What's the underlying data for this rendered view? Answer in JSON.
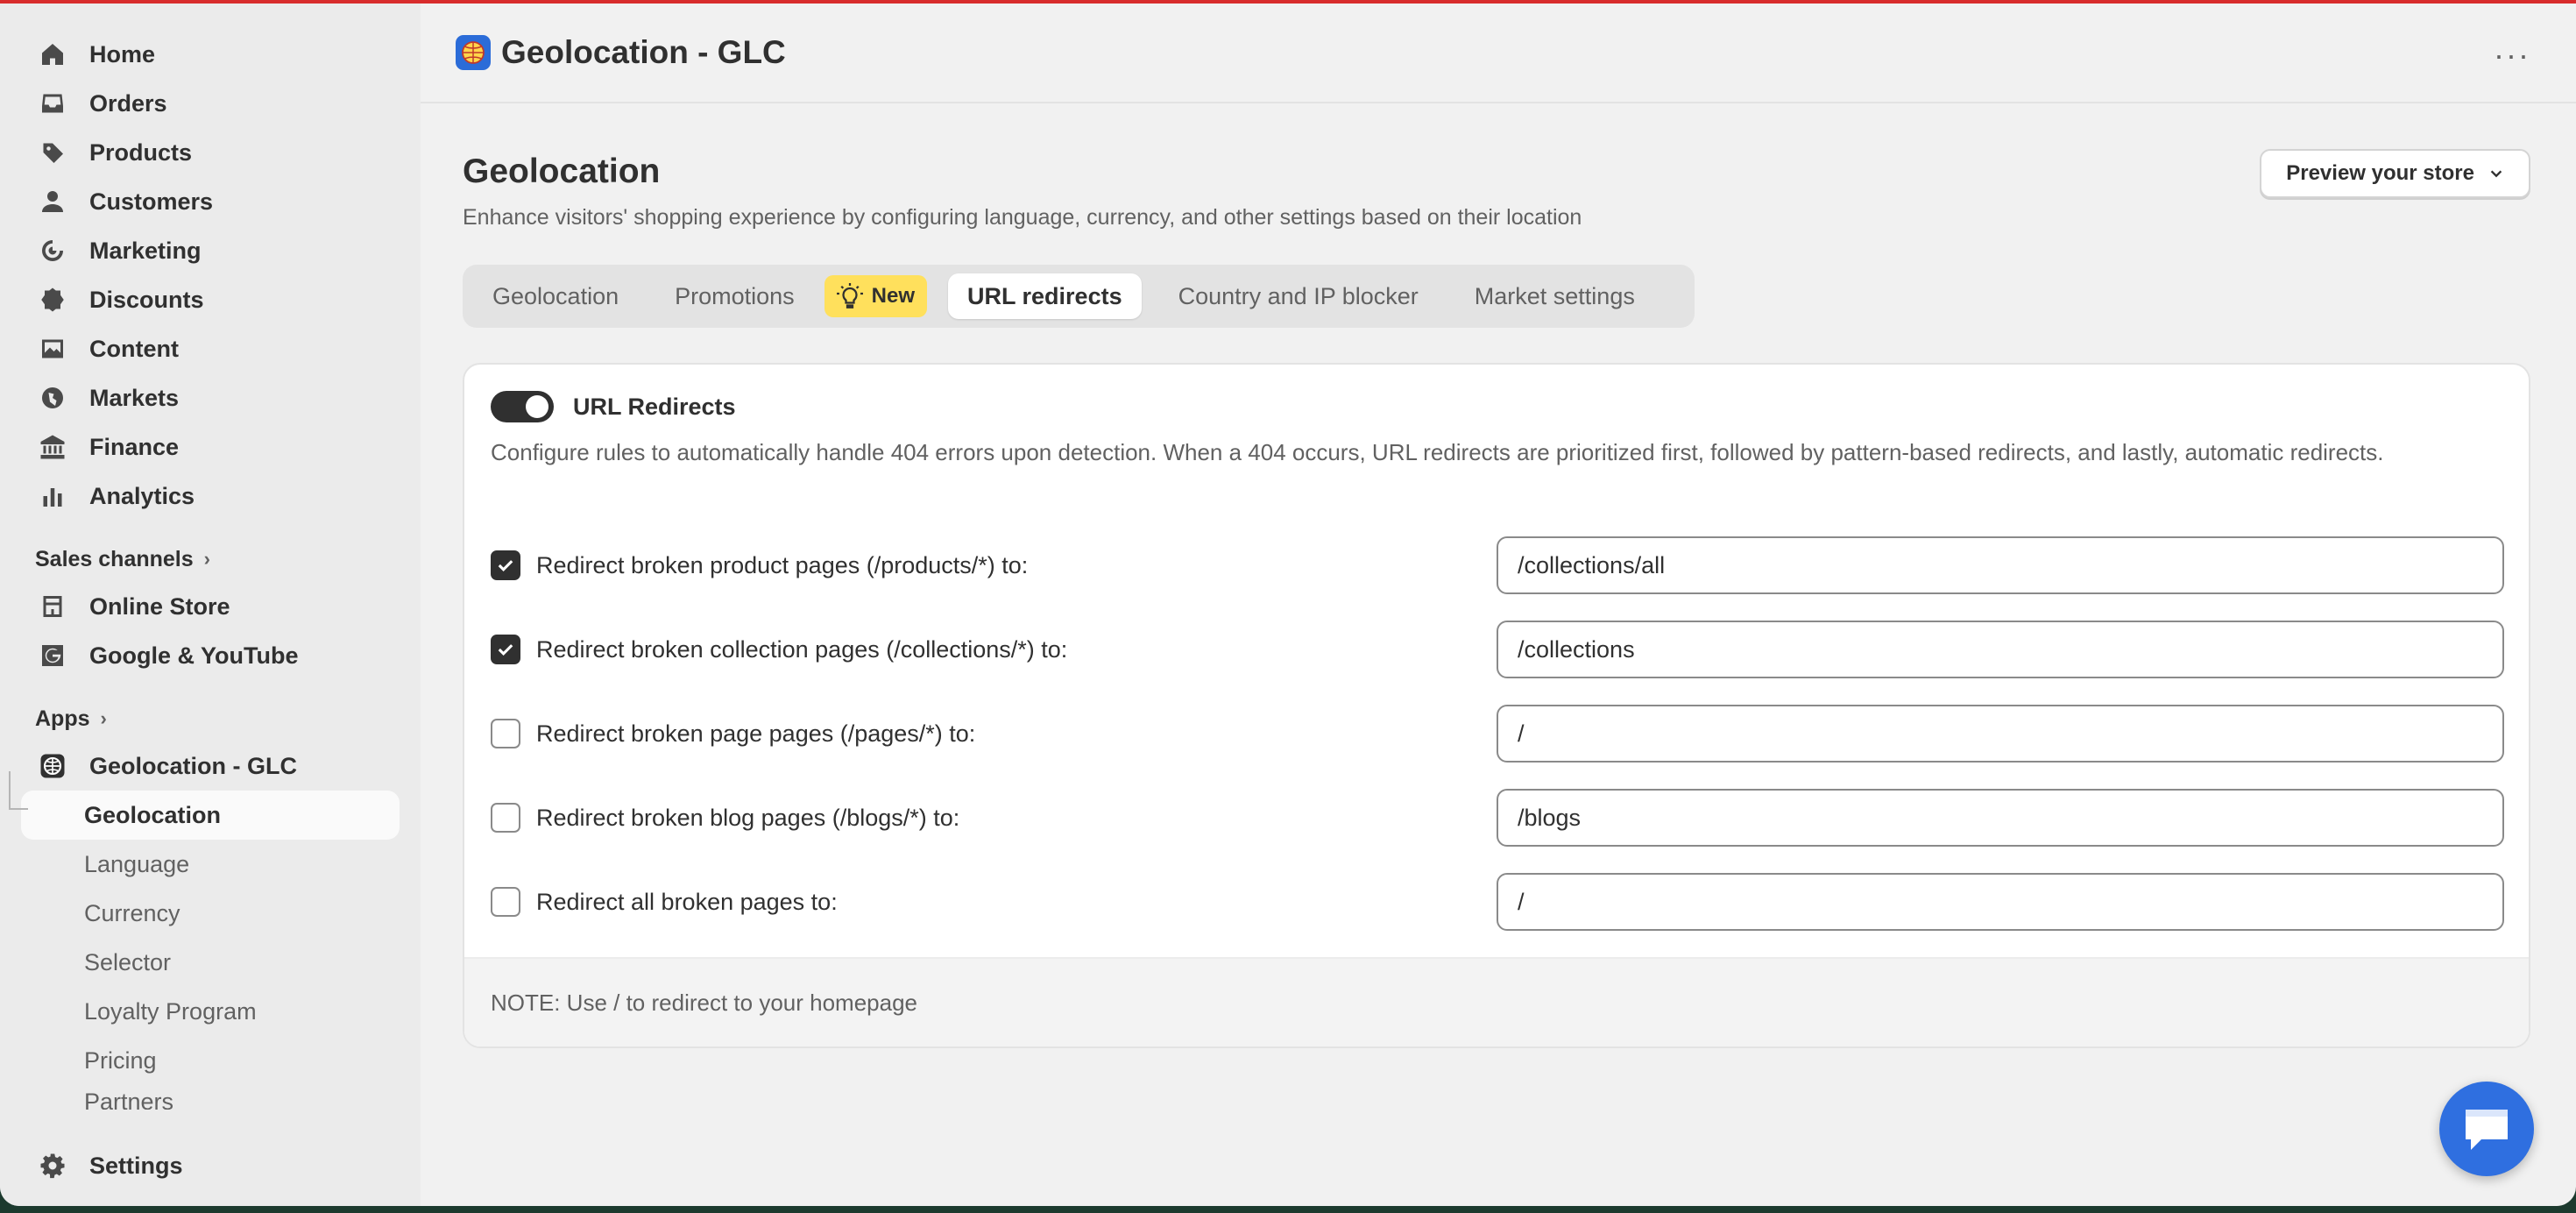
{
  "sidebar": {
    "nav": [
      {
        "label": "Home",
        "icon": "home-icon"
      },
      {
        "label": "Orders",
        "icon": "inbox-icon"
      },
      {
        "label": "Products",
        "icon": "tag-icon"
      },
      {
        "label": "Customers",
        "icon": "person-icon"
      },
      {
        "label": "Marketing",
        "icon": "target-icon"
      },
      {
        "label": "Discounts",
        "icon": "discount-icon"
      },
      {
        "label": "Content",
        "icon": "image-icon"
      },
      {
        "label": "Markets",
        "icon": "globe-icon"
      },
      {
        "label": "Finance",
        "icon": "bank-icon"
      },
      {
        "label": "Analytics",
        "icon": "bar-chart-icon"
      }
    ],
    "sales_channels_label": "Sales channels",
    "channels": [
      {
        "label": "Online Store",
        "icon": "store-icon"
      },
      {
        "label": "Google & YouTube",
        "icon": "google-icon"
      }
    ],
    "apps_label": "Apps",
    "app": {
      "label": "Geolocation - GLC",
      "icon": "geolocation-app-icon"
    },
    "app_subitems": [
      "Geolocation",
      "Language",
      "Currency",
      "Selector",
      "Loyalty Program",
      "Pricing",
      "Partners"
    ],
    "settings_label": "Settings"
  },
  "topbar": {
    "title": "Geolocation - GLC",
    "more": "···"
  },
  "page": {
    "title": "Geolocation",
    "subtitle": "Enhance visitors' shopping experience by configuring language, currency, and other settings based on their location",
    "preview_button": "Preview your store"
  },
  "tabs": {
    "items": [
      "Geolocation",
      "Promotions",
      "URL redirects",
      "Country and IP blocker",
      "Market settings"
    ],
    "new_badge": "New",
    "active": "URL redirects"
  },
  "card": {
    "title": "URL Redirects",
    "enabled": true,
    "description": "Configure rules to automatically handle 404 errors upon detection. When a 404 occurs, URL redirects are prioritized first, followed by pattern-based redirects, and lastly, automatic redirects.",
    "rules": [
      {
        "label": "Redirect broken product pages (/products/*) to:",
        "checked": true,
        "value": "/collections/all"
      },
      {
        "label": "Redirect broken collection pages (/collections/*) to:",
        "checked": true,
        "value": "/collections"
      },
      {
        "label": "Redirect broken page pages (/pages/*) to:",
        "checked": false,
        "value": "/"
      },
      {
        "label": "Redirect broken blog pages (/blogs/*) to:",
        "checked": false,
        "value": "/blogs"
      },
      {
        "label": "Redirect all broken pages to:",
        "checked": false,
        "value": "/"
      }
    ],
    "note": "NOTE: Use / to redirect to your homepage"
  },
  "colors": {
    "accent": "#d82c2c",
    "badge": "#ffe05c",
    "chat": "#2f6fe0"
  }
}
